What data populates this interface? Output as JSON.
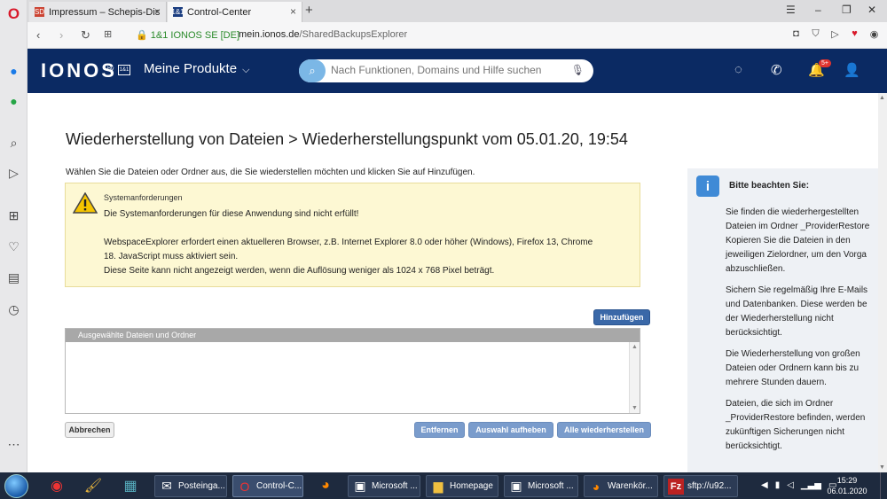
{
  "browser": {
    "tabs": [
      {
        "label": "Impressum – Schepis-Disco",
        "favicon": "SD"
      },
      {
        "label": "Control-Center",
        "favicon": "1&1"
      }
    ],
    "new_tab": "+",
    "secure_label": "1&1 IONOS SE [DE]",
    "url_domain": "mein.ionos.de",
    "url_path": "/SharedBackupsExplorer"
  },
  "header": {
    "logo": "IONOS",
    "logo_by": "by",
    "logo_box": "1&1",
    "products_label": "Meine Produkte",
    "search_placeholder": "Nach Funktionen, Domains und Hilfe suchen",
    "notification_badge": "5+"
  },
  "main": {
    "title": "Wiederherstellung von Dateien > Wiederherstellungspunkt vom 05.01.20, 19:54",
    "instruction": "Wählen Sie die Dateien oder Ordner aus, die Sie wiederstellen möchten und klicken Sie auf Hinzufügen.",
    "warning": {
      "title": "Systemanforderungen",
      "line1": "Die Systemanforderungen für diese Anwendung sind nicht erfüllt!",
      "line2": "WebspaceExplorer erfordert einen aktuelleren Browser, z.B. Internet Explorer 8.0 oder höher (Windows), Firefox 13, Chrome",
      "line3": "18. JavaScript muss aktiviert sein.",
      "line4": "Diese Seite kann nicht angezeigt werden, wenn die Auflösung weniger als 1024 x 768 Pixel beträgt."
    },
    "add_button": "Hinzufügen",
    "selection_header": "Ausgewählte Dateien und Ordner",
    "cancel_button": "Abbrechen",
    "remove_button": "Entfernen",
    "deselect_button": "Auswahl aufheben",
    "restore_all_button": "Alle wiederherstellen"
  },
  "info": {
    "title": "Bitte beachten Sie:",
    "p1": [
      "Sie finden die wiederhergestellten",
      "Dateien im Ordner _ProviderRestore",
      "Kopieren Sie die Dateien in den",
      "jeweiligen Zielordner, um den Vorga",
      "abzuschließen."
    ],
    "p2": [
      "Sichern Sie regelmäßig Ihre E-Mails",
      "und Datenbanken. Diese werden be",
      "der Wiederherstellung nicht",
      "berücksichtigt."
    ],
    "p3": [
      "Die Wiederherstellung von großen",
      "Dateien oder Ordnern kann bis zu",
      "mehrere Stunden dauern."
    ],
    "p4": [
      "Dateien, die sich im Ordner",
      "_ProviderRestore befinden, werden",
      "zukünftigen Sicherungen nicht",
      "berücksichtigt."
    ]
  },
  "taskbar": {
    "apps": [
      "Posteinga...",
      "Control-C...",
      "Microsoft ...",
      "Homepage",
      "Microsoft ...",
      "Warenkör...",
      "sftp://u92..."
    ],
    "time": "15:29",
    "date": "06.01.2020"
  },
  "colors": {
    "ionos_navy": "#0b2a63",
    "button_blue": "#3a68a8",
    "warning_bg": "#fdf8d3",
    "opera_red": "#d8192b"
  }
}
